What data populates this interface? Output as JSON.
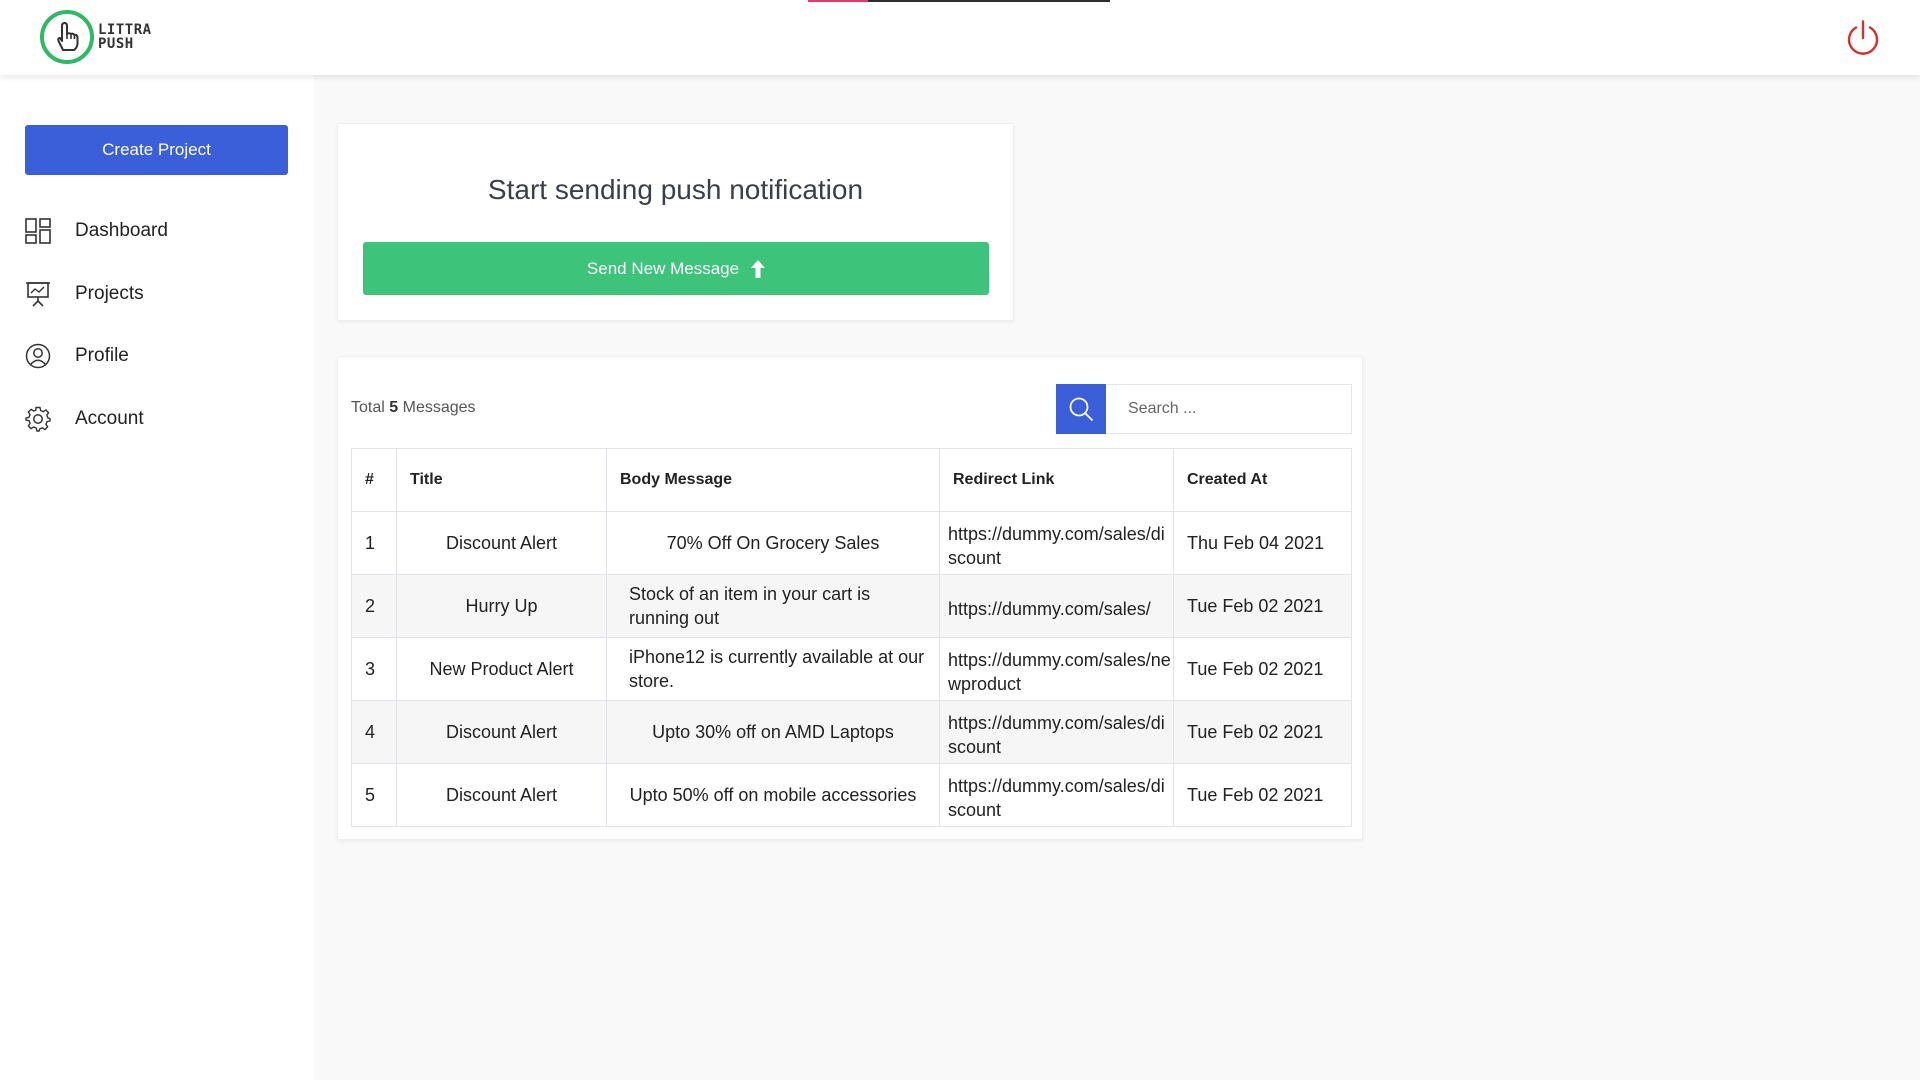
{
  "app": {
    "logo_line1": "LITTRA",
    "logo_line2": "PUSH"
  },
  "header": {
    "loading_progress": 0.2
  },
  "sidebar": {
    "create_project_label": "Create Project",
    "items": [
      {
        "label": "Dashboard",
        "icon": "dashboard-icon"
      },
      {
        "label": "Projects",
        "icon": "presentation-icon"
      },
      {
        "label": "Profile",
        "icon": "user-circle-icon"
      },
      {
        "label": "Account",
        "icon": "gear-icon"
      }
    ]
  },
  "hero": {
    "title": "Start sending push notification",
    "send_label": "Send New Message"
  },
  "messages": {
    "total_prefix": "Total",
    "total_count": "5",
    "total_suffix": "Messages",
    "search_placeholder": "Search ...",
    "columns": [
      "#",
      "Title",
      "Body Message",
      "Redirect Link",
      "Created At"
    ],
    "rows": [
      {
        "num": "1",
        "title": "Discount Alert",
        "body": "70% Off On Grocery Sales",
        "link": "https://dummy.com/sales/discount",
        "created": "Thu Feb 04 2021"
      },
      {
        "num": "2",
        "title": "Hurry Up",
        "body": "Stock of an item in your cart is running out",
        "link": "https://dummy.com/sales/",
        "created": "Tue Feb 02 2021"
      },
      {
        "num": "3",
        "title": "New Product Alert",
        "body": "iPhone12 is currently available at our store.",
        "link": "https://dummy.com/sales/newproduct",
        "created": "Tue Feb 02 2021"
      },
      {
        "num": "4",
        "title": "Discount Alert",
        "body": "Upto 30% off on AMD Laptops",
        "link": "https://dummy.com/sales/discount",
        "created": "Tue Feb 02 2021"
      },
      {
        "num": "5",
        "title": "Discount Alert",
        "body": "Upto 50% off on mobile accessories",
        "link": "https://dummy.com/sales/discount",
        "created": "Tue Feb 02 2021"
      }
    ]
  },
  "colors": {
    "primary": "#3b5fd8",
    "success": "#3ec37a",
    "logo_green": "#2fb865",
    "power_red": "#d62f2f",
    "progress_pink": "#e8386d"
  }
}
